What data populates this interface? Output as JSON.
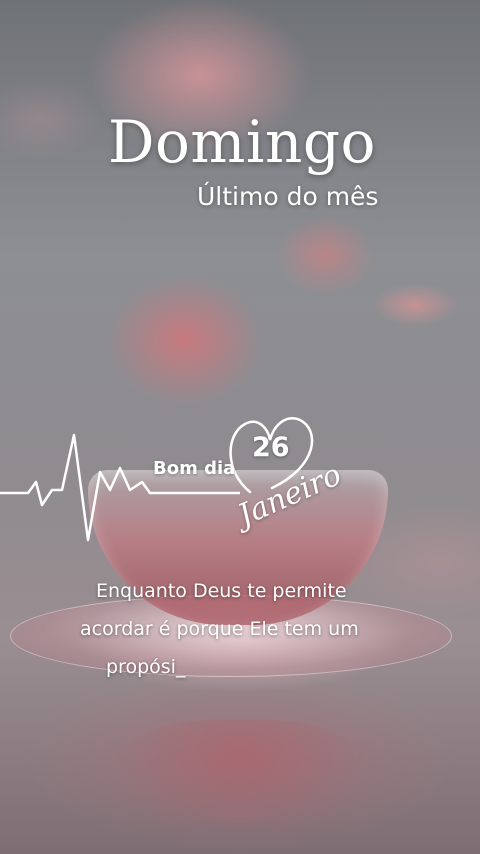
{
  "card": {
    "title": "Domingo",
    "subtitle": "Último do mês",
    "greeting": "Bom dia",
    "day": "26",
    "month": "Janeiro",
    "message_lines": [
      "Enquanto Deus te permite",
      "acordar é porque Ele tem um",
      "propósi_"
    ]
  },
  "colors": {
    "text": "#ffffff",
    "rose": "#d08a90",
    "background": "#8a8d92"
  }
}
